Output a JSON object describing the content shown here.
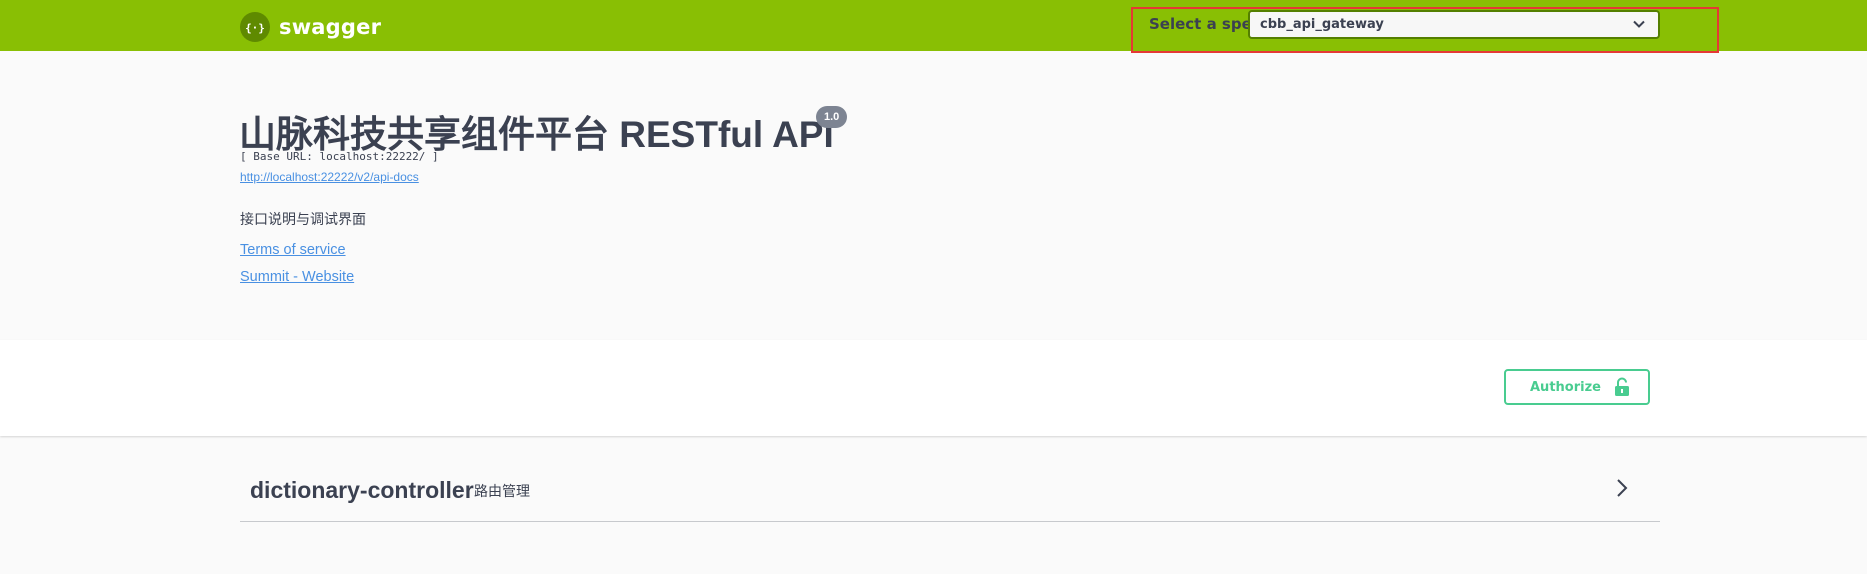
{
  "topbar": {
    "logo_text": "swagger",
    "spec_label": "Select a spec",
    "spec_selected": "cbb_api_gateway",
    "colors": {
      "background": "#89bf04",
      "highlight_box": "#e53935"
    }
  },
  "info": {
    "title": "山脉科技共享组件平台 RESTful API",
    "version": "1.0",
    "base_url": "[ Base URL: localhost:22222/ ]",
    "docs_url": "http://localhost:22222/v2/api-docs",
    "description": "接口说明与调试界面",
    "terms_link": "Terms of service",
    "website_link": "Summit - Website"
  },
  "auth": {
    "authorize_label": "Authorize",
    "icon": "lock-open-icon",
    "color": "#49cc90"
  },
  "tags": [
    {
      "name": "dictionary-controller",
      "description": "路由管理",
      "icon": "chevron-right-icon"
    }
  ]
}
